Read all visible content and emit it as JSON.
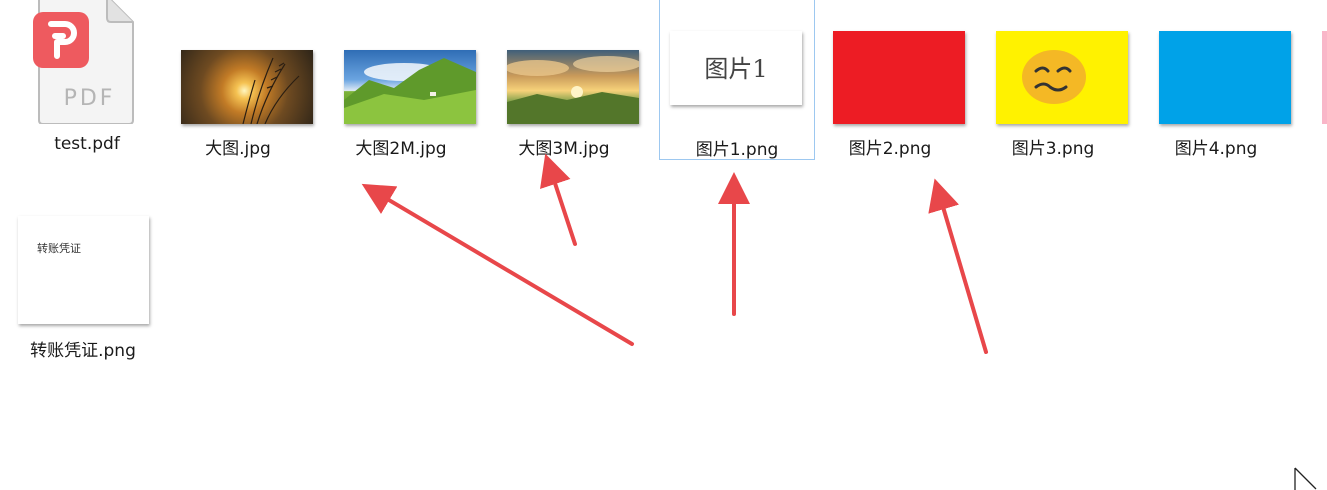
{
  "files": [
    {
      "name": "test.pdf",
      "icon": "pdf-file-icon",
      "icon_text": "PDF"
    },
    {
      "name": "大图.jpg",
      "icon": "sunset-grass-photo-thumbnail"
    },
    {
      "name": "大图2M.jpg",
      "icon": "green-mountain-photo-thumbnail"
    },
    {
      "name": "大图3M.jpg",
      "icon": "sunset-landscape-photo-thumbnail"
    },
    {
      "name": "图片1.png",
      "icon": "text-image-thumbnail",
      "thumb_text": "图片1",
      "selected": true
    },
    {
      "name": "图片2.png",
      "icon": "red-image-thumbnail",
      "color": "#ed1c24"
    },
    {
      "name": "图片3.png",
      "icon": "yellow-emoji-thumbnail",
      "color": "#fff200"
    },
    {
      "name": "图片4.png",
      "icon": "blue-image-thumbnail",
      "color": "#00a2e8"
    },
    {
      "name": "转账凭证.png",
      "icon": "document-image-thumbnail",
      "thumb_text": "转账凭证"
    }
  ],
  "annotations": {
    "arrow_color": "#e8474a"
  },
  "accent": {
    "pdf_red": "#ee5a5f",
    "selection_border": "#9dc8f0",
    "partial_pink": "#f9b6c8"
  }
}
